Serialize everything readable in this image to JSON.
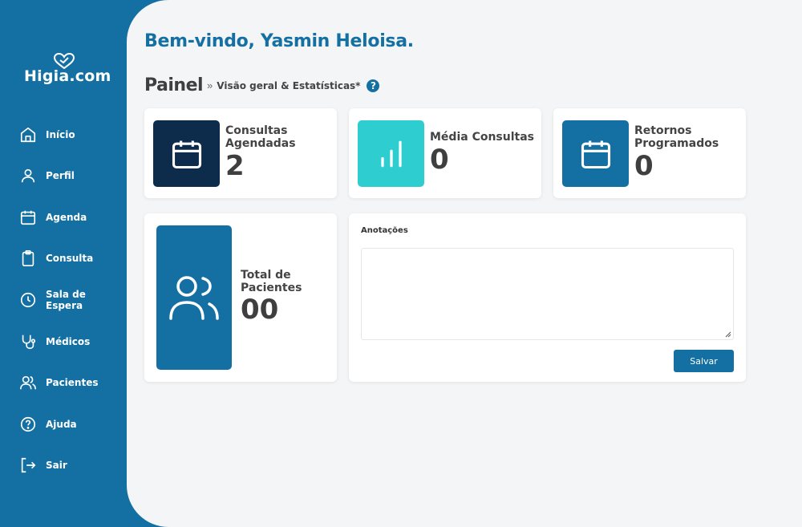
{
  "app": {
    "logo_text": "Higia.com"
  },
  "sidebar": {
    "items": [
      {
        "label": "Início",
        "icon": "home-icon"
      },
      {
        "label": "Perfil",
        "icon": "user-icon"
      },
      {
        "label": "Agenda",
        "icon": "calendar-icon"
      },
      {
        "label": "Consulta",
        "icon": "clipboard-icon"
      },
      {
        "label": "Sala de Espera",
        "icon": "clock-icon"
      },
      {
        "label": "Médicos",
        "icon": "stethoscope-icon"
      },
      {
        "label": "Pacientes",
        "icon": "users-icon"
      },
      {
        "label": "Ajuda",
        "icon": "help-circle-icon"
      },
      {
        "label": "Sair",
        "icon": "logout-icon"
      }
    ]
  },
  "header": {
    "welcome": "Bem-vindo, Yasmin Heloisa.",
    "title": "Painel",
    "separator": "»",
    "subtitle": "Visão geral & Estatísticas*",
    "help_glyph": "?"
  },
  "stats": [
    {
      "label": "Consultas Agendadas",
      "value": "2",
      "icon": "calendar-icon",
      "color": "#0d2b4a"
    },
    {
      "label": "Média Consultas",
      "value": "0",
      "icon": "bar-chart-icon",
      "color": "#2ecdd0"
    },
    {
      "label": "Retornos Programados",
      "value": "0",
      "icon": "calendar-icon",
      "color": "#1470a3"
    }
  ],
  "patients": {
    "label": "Total de Pacientes",
    "value": "00",
    "icon": "users-icon",
    "color": "#1470a3"
  },
  "notes": {
    "label": "Anotações",
    "value": "",
    "save_label": "Salvar"
  },
  "colors": {
    "primary": "#1470a3",
    "background": "#f4f5f7",
    "dark": "#0d2b4a",
    "teal": "#2ecdd0"
  }
}
